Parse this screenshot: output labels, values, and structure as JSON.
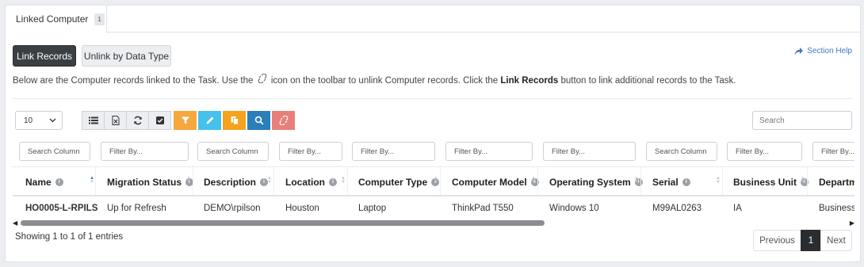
{
  "tab": {
    "label": "Linked Computer",
    "count": "1"
  },
  "actions": {
    "link": "Link Records",
    "unlink": "Unlink by Data Type"
  },
  "help": {
    "label": "Section Help",
    "icon": "share-arrow-icon"
  },
  "intro": {
    "part1": "Below are the Computer records linked to the Task. Use the",
    "part2": "icon on the toolbar to unlink Computer records. Click the",
    "bold": "Link Records",
    "part3": "button to link additional records to the Task."
  },
  "pagesize": {
    "value": "10"
  },
  "toolbar": [
    {
      "icon": "list-icon"
    },
    {
      "icon": "export-excel-icon"
    },
    {
      "icon": "refresh-icon"
    },
    {
      "icon": "checkbox-icon"
    },
    {
      "icon": "filter-icon",
      "color": "#f5a83e"
    },
    {
      "icon": "pencil-icon",
      "color": "#45c2ec"
    },
    {
      "icon": "copy-icon",
      "color": "#f5a21e"
    },
    {
      "icon": "search-icon",
      "color": "#2b7fb8"
    },
    {
      "icon": "unlink-icon",
      "color": "#e87f79"
    }
  ],
  "search": {
    "placeholder": "Search"
  },
  "table": {
    "filters": [
      "Search Column",
      "Filter By...",
      "Search Column",
      "Filter By...",
      "Filter By...",
      "Filter By...",
      "Filter By...",
      "Search Column",
      "Filter By...",
      "Filter By..."
    ],
    "columns": [
      "Name",
      "Migration Status",
      "Description",
      "Location",
      "Computer Type",
      "Computer Model",
      "Operating System",
      "Serial",
      "Business Unit",
      "Departme"
    ],
    "rows": [
      [
        "HO0005-L-RPILS",
        "Up for Refresh",
        "DEMO\\rpilson",
        "Houston",
        "Laptop",
        "ThinkPad T550",
        "Windows 10",
        "M99AL0263",
        "IA",
        "Business A"
      ]
    ]
  },
  "footer": {
    "showing": "Showing 1 to 1 of 1 entries"
  },
  "pagination": {
    "previous": "Previous",
    "current": "1",
    "next": "Next"
  }
}
